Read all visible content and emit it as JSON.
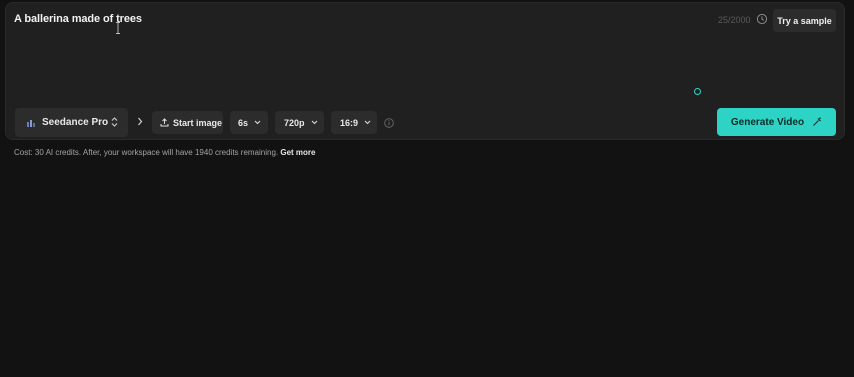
{
  "prompt": {
    "text": "A ballerina made of trees",
    "char_count": "25/2000",
    "try_sample_label": "Try a sample"
  },
  "toolbar": {
    "model_label": "Seedance Pro",
    "start_image_label": "Start image",
    "duration_value": "6s",
    "resolution_value": "720p",
    "aspect_ratio_value": "16:9",
    "generate_label": "Generate Video"
  },
  "footer": {
    "cost_text": "Cost: 30 AI credits. After, your workspace will have 1940 credits remaining.",
    "get_more_label": "Get more"
  },
  "colors": {
    "background": "#121212",
    "panel": "#202020",
    "chip": "#2c2c2c",
    "accent": "#2dd4c6"
  },
  "icons": [
    "ibeam-cursor-icon",
    "history-icon",
    "status-dot-icon",
    "model-logo-icon",
    "updown-icon",
    "chevron-right-icon",
    "upload-icon",
    "chevron-down-icon",
    "info-icon",
    "wand-icon"
  ]
}
